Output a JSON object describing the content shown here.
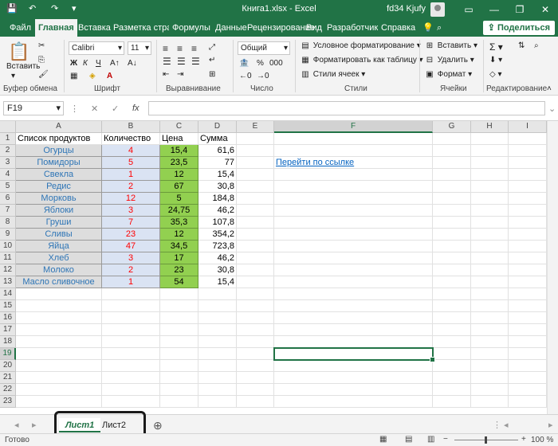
{
  "titlebar": {
    "title": "Книга1.xlsx  -  Excel",
    "user": "fd34 Kjufy",
    "minimize": "—",
    "restore": "❐",
    "close": "✕",
    "save_icon": "💾",
    "undo_icon": "↶",
    "redo_icon": "↷",
    "more_icon": "▾"
  },
  "tabs": [
    "Файл",
    "Главная",
    "Вставка",
    "Разметка страни",
    "Формулы",
    "Данные",
    "Рецензирование",
    "Вид",
    "Разработчик",
    "Справка"
  ],
  "tell_me": "?",
  "share_label": "Поделиться",
  "ribbon": {
    "clipboard": {
      "paste": "Вставить",
      "label": "Буфер обмена"
    },
    "font": {
      "name": "Calibri",
      "size": "11",
      "label": "Шрифт",
      "bold": "Ж",
      "italic": "К",
      "underline": "Ч"
    },
    "alignment": {
      "label": "Выравнивание"
    },
    "number": {
      "format": "Общий",
      "label": "Число"
    },
    "styles": {
      "conditional": "Условное форматирование",
      "as_table": "Форматировать как таблицу",
      "cell_styles": "Стили ячеек",
      "label": "Стили"
    },
    "cells": {
      "insert": "Вставить",
      "delete": "Удалить",
      "format": "Формат",
      "label": "Ячейки"
    },
    "editing": {
      "label": "Редактирование"
    }
  },
  "formula_bar": {
    "name_box": "F19",
    "fx": "fx",
    "value": ""
  },
  "columns": [
    "A",
    "B",
    "C",
    "D",
    "E",
    "F",
    "G",
    "H",
    "I"
  ],
  "rows": [
    "1",
    "2",
    "3",
    "4",
    "5",
    "6",
    "7",
    "8",
    "9",
    "10",
    "11",
    "12",
    "13",
    "14",
    "15",
    "16",
    "17",
    "18",
    "19",
    "20",
    "21",
    "22",
    "23"
  ],
  "headers": {
    "a": "Список продуктов",
    "b": "Количество",
    "c": "Цена",
    "d": "Сумма"
  },
  "table": [
    {
      "a": "Огурцы",
      "b": "4",
      "c": "15,4",
      "d": "61,6"
    },
    {
      "a": "Помидоры",
      "b": "5",
      "c": "23,5",
      "d": "77"
    },
    {
      "a": "Свекла",
      "b": "1",
      "c": "12",
      "d": "15,4"
    },
    {
      "a": "Редис",
      "b": "2",
      "c": "67",
      "d": "30,8"
    },
    {
      "a": "Морковь",
      "b": "12",
      "c": "5",
      "d": "184,8"
    },
    {
      "a": "Яблоки",
      "b": "3",
      "c": "24,75",
      "d": "46,2"
    },
    {
      "a": "Груши",
      "b": "7",
      "c": "35,3",
      "d": "107,8"
    },
    {
      "a": "Сливы",
      "b": "23",
      "c": "12",
      "d": "354,2"
    },
    {
      "a": "Яйца",
      "b": "47",
      "c": "34,5",
      "d": "723,8"
    },
    {
      "a": "Хлеб",
      "b": "3",
      "c": "17",
      "d": "46,2"
    },
    {
      "a": "Молоко",
      "b": "2",
      "c": "23",
      "d": "30,8"
    },
    {
      "a": "Масло сливочное",
      "b": "1",
      "c": "54",
      "d": "15,4"
    }
  ],
  "hyperlink": "Перейти по ссылке",
  "selected": {
    "cell": "F19",
    "column": "F",
    "row": "19"
  },
  "sheets": [
    "Лист1",
    "Лист2"
  ],
  "active_sheet": "Лист1",
  "add_sheet": "⊕",
  "status": {
    "ready": "Готово",
    "zoom": "100 %"
  }
}
